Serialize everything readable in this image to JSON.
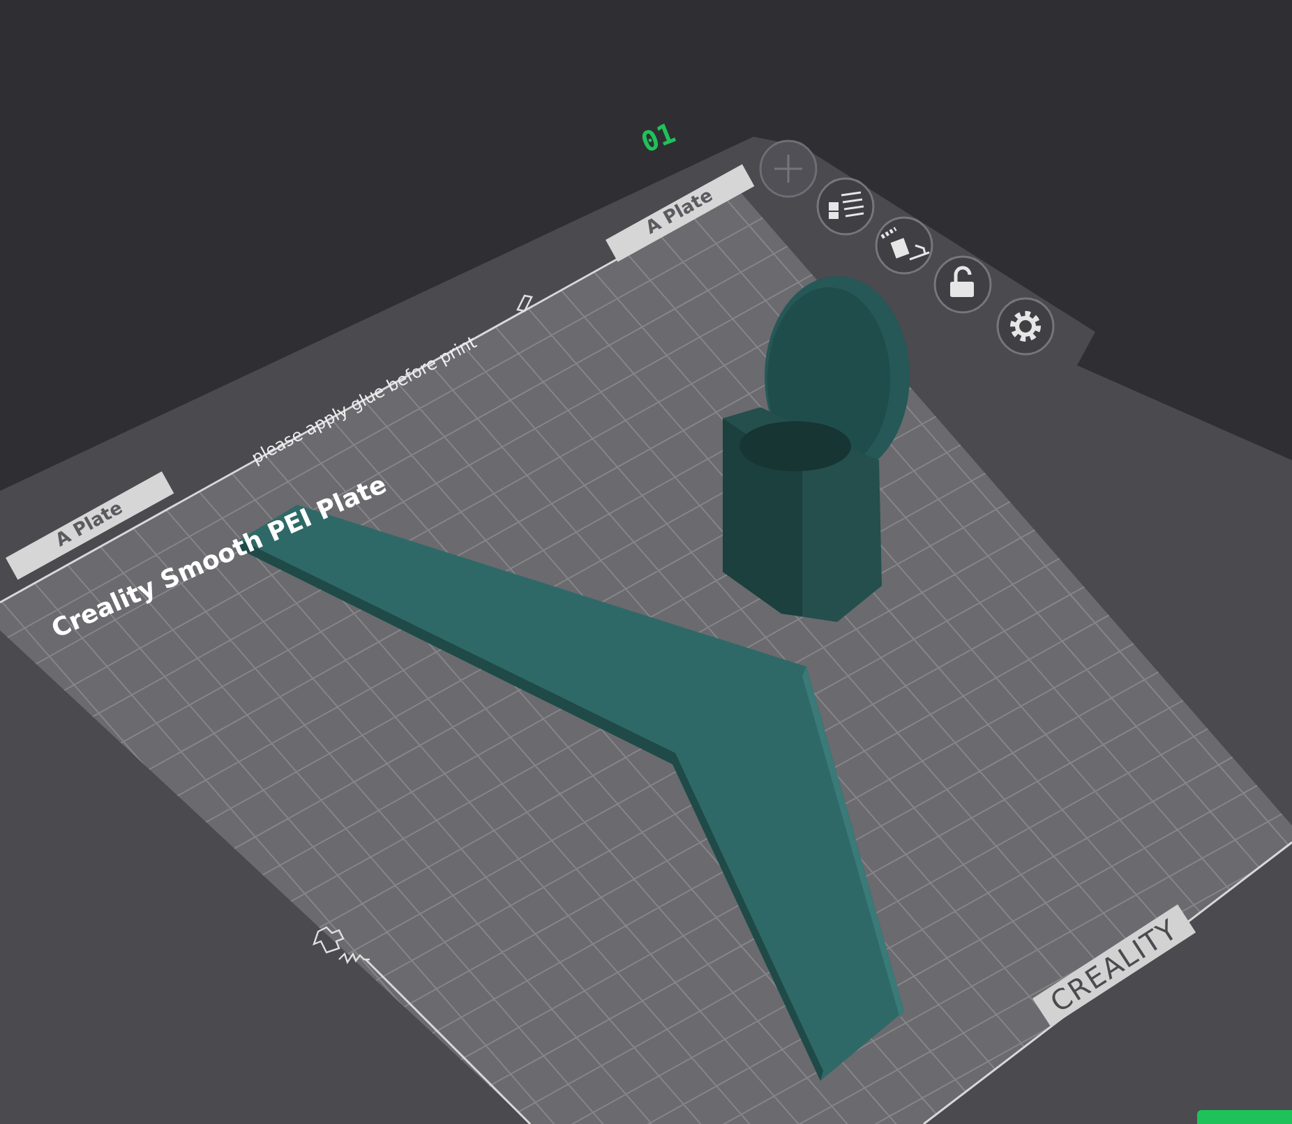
{
  "plate_number": "01",
  "plate_tabs": [
    {
      "label": "A Plate"
    },
    {
      "label": "A Plate"
    }
  ],
  "plate_note": "please apply glue before print",
  "plate_name": "Creality Smooth PEI Plate",
  "bed_logo": "CREALITY"
}
